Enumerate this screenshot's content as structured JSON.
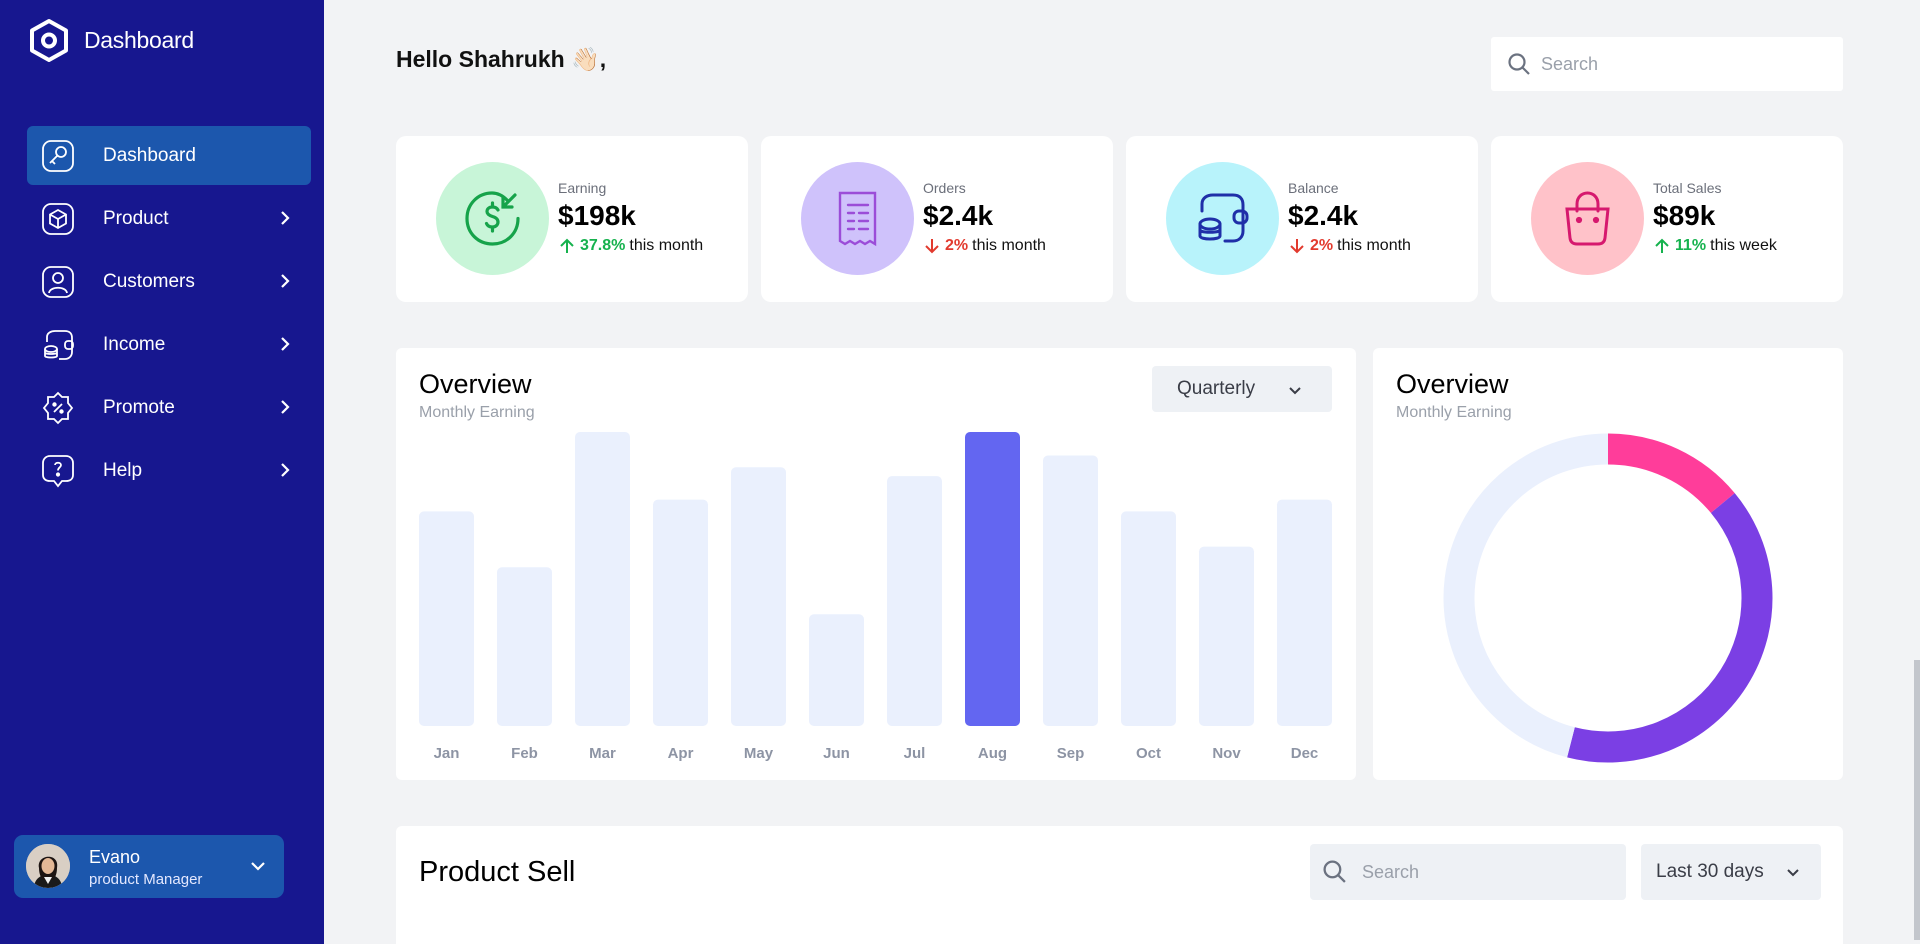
{
  "app": {
    "brand": "Dashboard"
  },
  "sidebar": {
    "items": [
      {
        "label": "Dashboard",
        "icon": "key-icon",
        "active": true
      },
      {
        "label": "Product",
        "icon": "cube-icon"
      },
      {
        "label": "Customers",
        "icon": "user-square-icon"
      },
      {
        "label": "Income",
        "icon": "wallet-icon"
      },
      {
        "label": "Promote",
        "icon": "discount-badge-icon"
      },
      {
        "label": "Help",
        "icon": "help-message-icon"
      }
    ],
    "profile": {
      "name": "Evano",
      "role": "product Manager"
    }
  },
  "header": {
    "greeting": "Hello Shahrukh 👋🏻,",
    "search_placeholder": "Search"
  },
  "stats": [
    {
      "title": "Earning",
      "value": "$198k",
      "delta": "37.8%",
      "direction": "up",
      "period": "this month",
      "icon": "dollar-refresh-icon",
      "bg": "#c8f5d8",
      "color": "#16a34a"
    },
    {
      "title": "Orders",
      "value": "$2.4k",
      "delta": "2%",
      "direction": "down",
      "period": "this month",
      "icon": "receipt-icon",
      "bg": "#cfc2fb",
      "color": "#9b4dd8"
    },
    {
      "title": "Balance",
      "value": "$2.4k",
      "delta": "2%",
      "direction": "down",
      "period": "this month",
      "icon": "wallet-coins-icon",
      "bg": "#b8f3fb",
      "color": "#1f2fa8"
    },
    {
      "title": "Total Sales",
      "value": "$89k",
      "delta": "11%",
      "direction": "up",
      "period": "this week",
      "icon": "shopping-bag-icon",
      "bg": "#ffc2c9",
      "color": "#d6196e"
    }
  ],
  "overview": {
    "title": "Overview",
    "subtitle": "Monthly Earning",
    "period": "Quarterly"
  },
  "chart_data": [
    {
      "type": "bar",
      "categories": [
        "Jan",
        "Feb",
        "Mar",
        "Apr",
        "May",
        "Jun",
        "Jul",
        "Aug",
        "Sep",
        "Oct",
        "Nov",
        "Dec"
      ],
      "values": [
        73,
        54,
        100,
        77,
        88,
        38,
        85,
        100,
        92,
        73,
        61,
        77
      ],
      "highlight_index": 7,
      "colors": {
        "bar": "#eaf0fd",
        "highlight": "#6366f1"
      }
    },
    {
      "type": "pie",
      "variant": "donut",
      "values": [
        14,
        40,
        46
      ],
      "colors": [
        "#ff3d9a",
        "#7b3fe4",
        "#eaf0fd"
      ]
    }
  ],
  "overview2": {
    "title": "Overview",
    "subtitle": "Monthly Earning"
  },
  "product_sell": {
    "title": "Product Sell",
    "search_placeholder": "Search",
    "period": "Last 30 days"
  }
}
